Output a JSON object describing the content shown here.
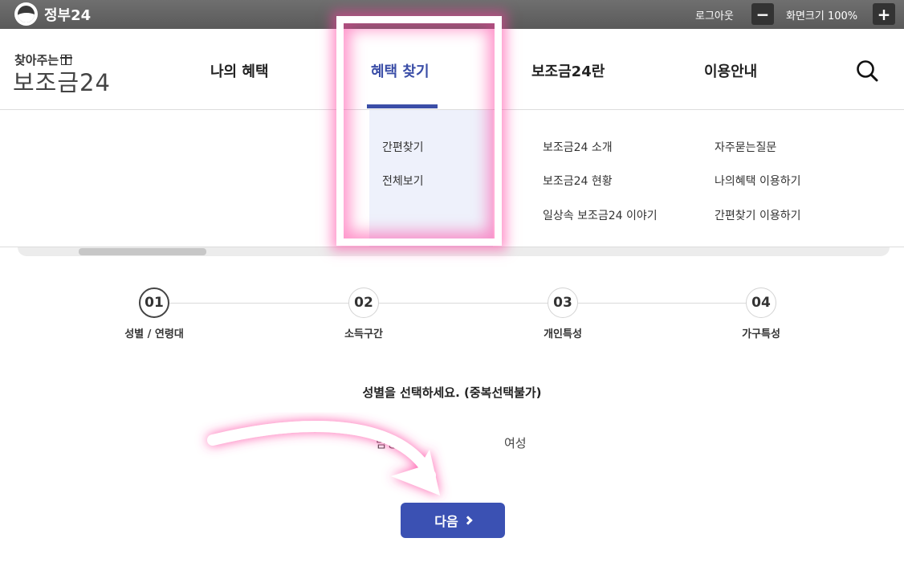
{
  "topbar": {
    "site_name": "정부24",
    "logout_label": "로그아웃",
    "zoom_minus": "−",
    "zoom_label": "화면크기 100%",
    "zoom_plus": "+"
  },
  "header": {
    "brand_small": "찾아주는",
    "brand_big": "보조금24",
    "nav": [
      "나의 혜택",
      "혜택 찾기",
      "보조금24란",
      "이용안내"
    ],
    "active_nav": "혜택 찾기",
    "accent_color": "#3b4ea7"
  },
  "mega_menu": {
    "find": [
      "간편찾기",
      "전체보기"
    ],
    "about": [
      "보조금24 소개",
      "보조금24 현황",
      "일상속 보조금24 이야기"
    ],
    "guide": [
      "자주묻는질문",
      "나의혜택 이용하기",
      "간편찾기 이용하기"
    ]
  },
  "steps": [
    {
      "num": "01",
      "label": "성별 / 연령대"
    },
    {
      "num": "02",
      "label": "소득구간"
    },
    {
      "num": "03",
      "label": "개인특성"
    },
    {
      "num": "04",
      "label": "가구특성"
    }
  ],
  "current_step": 1,
  "question": "성별을 선택하세요. (중복선택불가)",
  "options": [
    "남성",
    "여성"
  ],
  "next_button": "다음",
  "highlight_color": "#ff40a0"
}
